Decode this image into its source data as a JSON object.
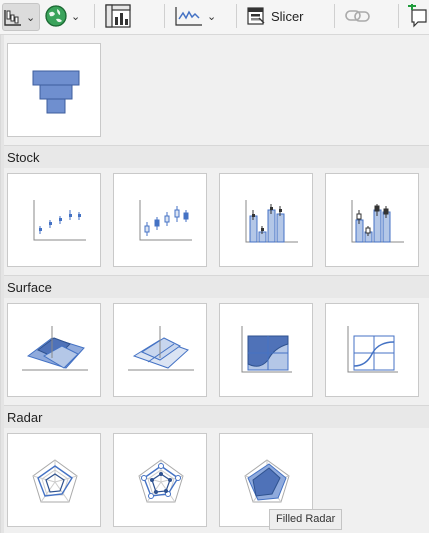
{
  "ribbon": {
    "slicer_label": "Slicer"
  },
  "sections": {
    "stock": "Stock",
    "surface": "Surface",
    "radar": "Radar"
  },
  "tooltip": "Filled Radar",
  "icons": {
    "waterfall": "waterfall-chart-icon",
    "globe": "map-chart-icon",
    "pivot": "pivot-chart-icon",
    "sparkline": "sparkline-icon",
    "slicer": "slicer-icon",
    "link": "link-icon",
    "comment": "new-comment-icon"
  },
  "colors": {
    "accent": "#4472c4",
    "fill_light": "#b4c7e7",
    "fill_mid": "#8faadc",
    "fill_dark": "#5b7fc4"
  }
}
